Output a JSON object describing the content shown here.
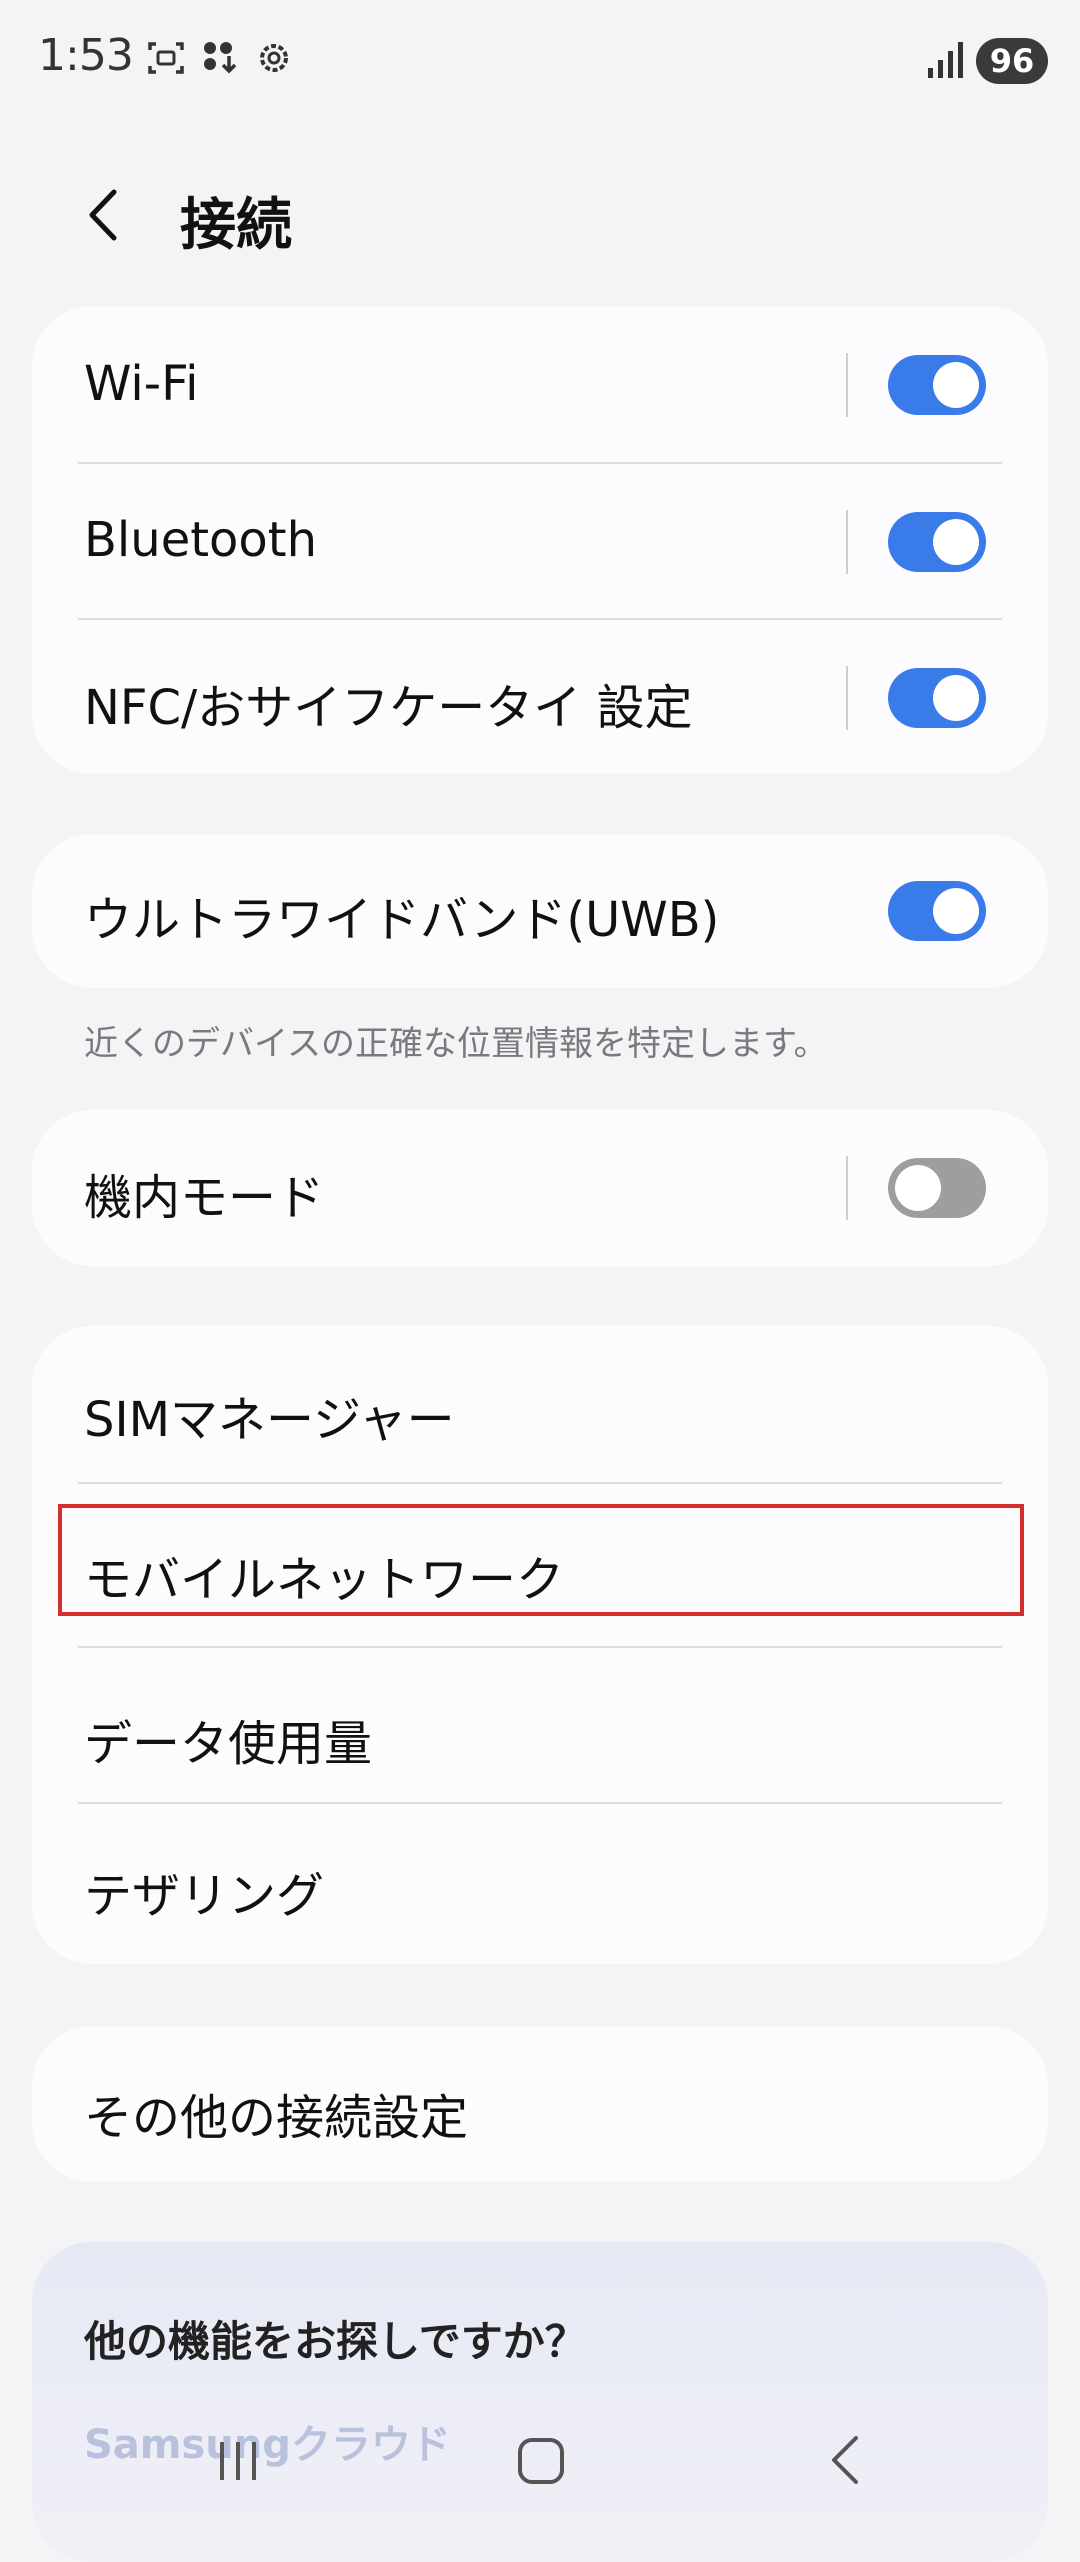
{
  "status_bar": {
    "time": "1:53",
    "battery": "96",
    "left_icons": [
      "screenshot-icon",
      "apps-download-icon",
      "settings-gear-icon"
    ],
    "right_icons": [
      "signal-icon",
      "battery-icon"
    ]
  },
  "header": {
    "title": "接続",
    "back_icon": "chevron-left-icon"
  },
  "group1": {
    "items": [
      {
        "label": "Wi-Fi",
        "toggle": true
      },
      {
        "label": "Bluetooth",
        "toggle": true
      },
      {
        "label": "NFC/おサイフケータイ 設定",
        "toggle": true
      }
    ]
  },
  "group2": {
    "label": "ウルトラワイドバンド(UWB)",
    "toggle": true,
    "description": "近くのデバイスの正確な位置情報を特定します。"
  },
  "group3": {
    "label": "機内モード",
    "toggle": false
  },
  "group4": {
    "items": [
      {
        "label": "SIMマネージャー"
      },
      {
        "label": "モバイルネットワーク"
      },
      {
        "label": "データ使用量"
      },
      {
        "label": "テザリング"
      }
    ]
  },
  "group5": {
    "label": "その他の接続設定"
  },
  "promo": {
    "title": "他の機能をお探しですか？",
    "link": "Samsungクラウド"
  },
  "nav": {
    "recents_icon": "recents-icon",
    "home_icon": "home-icon",
    "back_icon": "back-icon"
  },
  "colors": {
    "background": "#f4f4f6",
    "card": "#fcfcfe",
    "toggle_on": "#3a7bea",
    "toggle_off": "#9e9e9e",
    "highlight": "#d32f2f"
  }
}
